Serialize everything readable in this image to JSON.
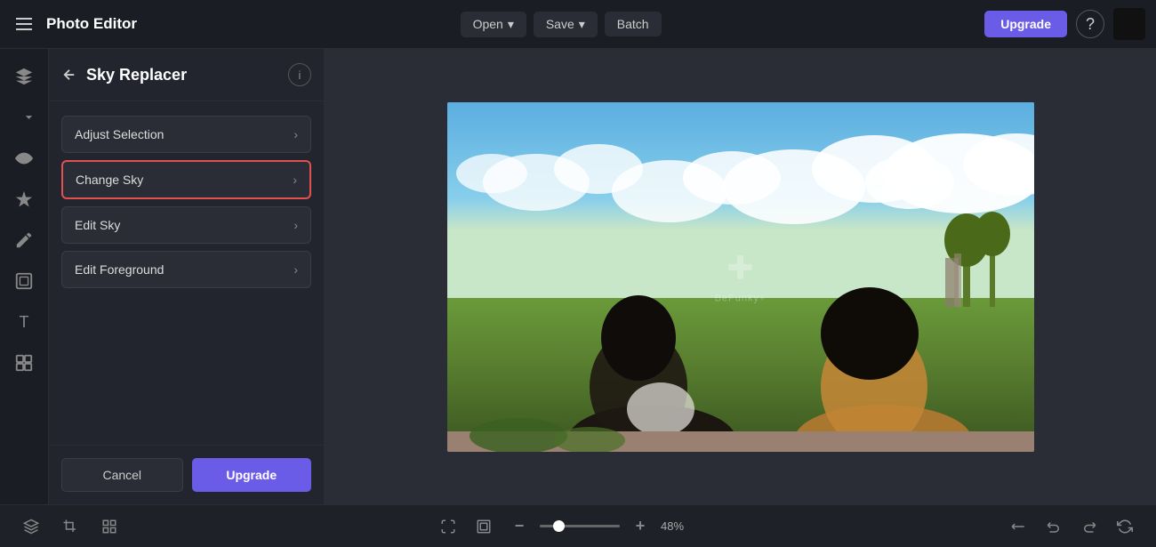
{
  "header": {
    "hamburger_label": "menu",
    "app_title": "Photo Editor",
    "open_label": "Open",
    "save_label": "Save",
    "batch_label": "Batch",
    "upgrade_label": "Upgrade",
    "help_label": "?"
  },
  "sidebar": {
    "icons": [
      {
        "name": "layers-icon",
        "symbol": "⊕"
      },
      {
        "name": "adjustments-icon",
        "symbol": "⊟"
      },
      {
        "name": "eye-icon",
        "symbol": "◎"
      },
      {
        "name": "magic-icon",
        "symbol": "✦"
      },
      {
        "name": "brush-icon",
        "symbol": "⊘"
      },
      {
        "name": "frames-icon",
        "symbol": "▣"
      },
      {
        "name": "text-icon",
        "symbol": "T"
      },
      {
        "name": "stickers-icon",
        "symbol": "❐"
      }
    ]
  },
  "panel": {
    "title": "Sky Replacer",
    "back_label": "←",
    "info_label": "i",
    "options": [
      {
        "label": "Adjust Selection",
        "selected": false
      },
      {
        "label": "Change Sky",
        "selected": true
      },
      {
        "label": "Edit Sky",
        "selected": false
      },
      {
        "label": "Edit Foreground",
        "selected": false
      }
    ],
    "cancel_label": "Cancel",
    "upgrade_label": "Upgrade"
  },
  "canvas": {
    "watermark_symbol": "✚",
    "watermark_text": "BeFunky+"
  },
  "bottom_toolbar": {
    "left_icons": [
      {
        "name": "layers-bottom-icon",
        "symbol": "⊕"
      },
      {
        "name": "crop-icon",
        "symbol": "⊡"
      },
      {
        "name": "grid-icon",
        "symbol": "⊞"
      }
    ],
    "fit_icon": {
      "name": "fit-screen-icon",
      "symbol": "⛶"
    },
    "crop_icon": {
      "name": "crop-corners-icon",
      "symbol": "⊠"
    },
    "zoom_minus_icon": {
      "name": "zoom-out-icon",
      "symbol": "−"
    },
    "zoom_plus_icon": {
      "name": "zoom-in-icon",
      "symbol": "+"
    },
    "zoom_value": "48",
    "zoom_unit": "%",
    "right_icons": [
      {
        "name": "flip-icon",
        "symbol": "↺"
      },
      {
        "name": "undo-icon",
        "symbol": "↩"
      },
      {
        "name": "redo-icon",
        "symbol": "↪"
      },
      {
        "name": "reset-icon",
        "symbol": "↺"
      }
    ]
  }
}
